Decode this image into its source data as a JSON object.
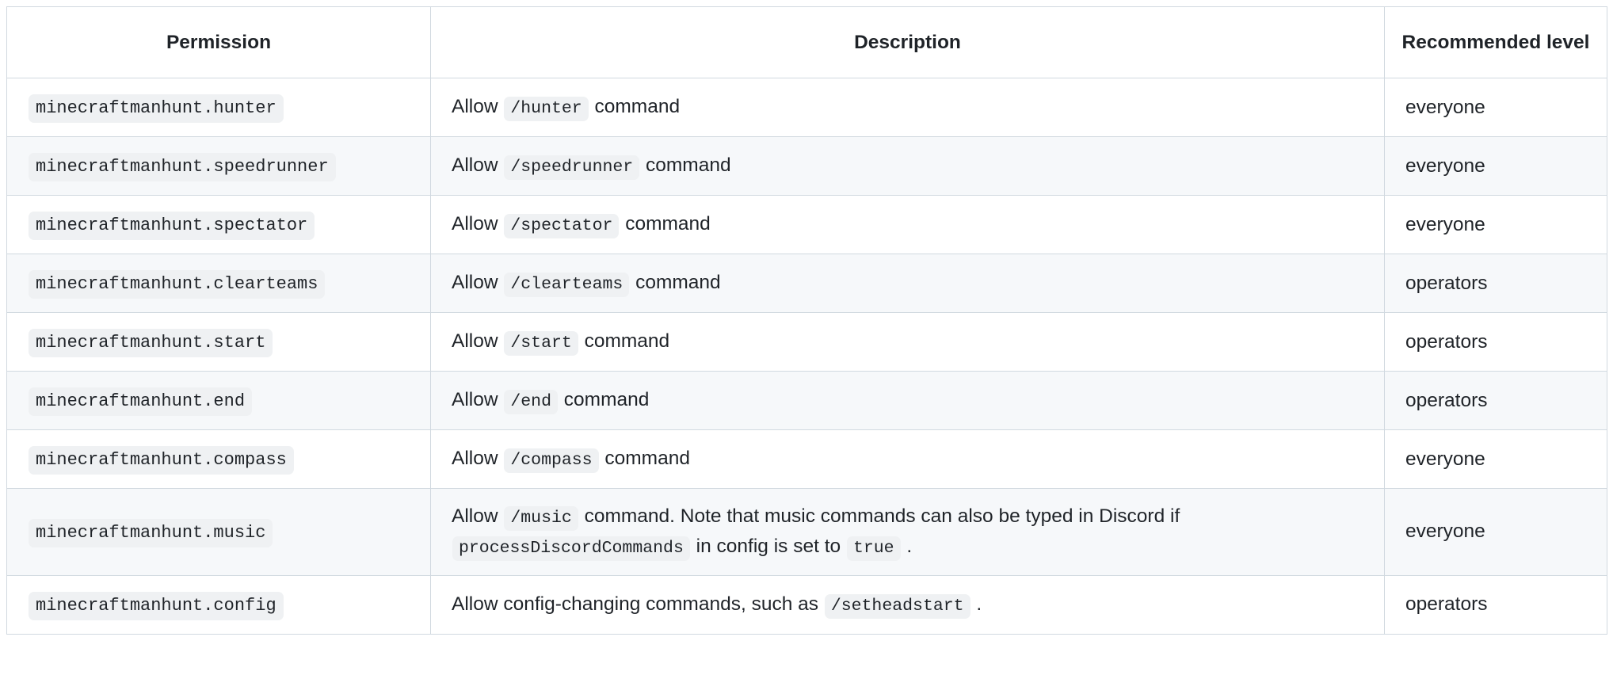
{
  "table": {
    "columns": [
      {
        "key": "permission",
        "label": "Permission",
        "align": "center"
      },
      {
        "key": "description",
        "label": "Description",
        "align": "center"
      },
      {
        "key": "level",
        "label": "Recommended level",
        "align": "center"
      }
    ],
    "headers": {
      "permission": "Permission",
      "description": "Description",
      "level": "Recommended level"
    },
    "rows": [
      {
        "permission": "minecraftmanhunt.hunter",
        "description": {
          "pre": "Allow",
          "code": "/hunter",
          "post": "command"
        },
        "level": "everyone"
      },
      {
        "permission": "minecraftmanhunt.speedrunner",
        "description": {
          "pre": "Allow",
          "code": "/speedrunner",
          "post": "command"
        },
        "level": "everyone"
      },
      {
        "permission": "minecraftmanhunt.spectator",
        "description": {
          "pre": "Allow",
          "code": "/spectator",
          "post": "command"
        },
        "level": "everyone"
      },
      {
        "permission": "minecraftmanhunt.clearteams",
        "description": {
          "pre": "Allow",
          "code": "/clearteams",
          "post": "command"
        },
        "level": "operators"
      },
      {
        "permission": "minecraftmanhunt.start",
        "description": {
          "pre": "Allow",
          "code": "/start",
          "post": "command"
        },
        "level": "operators"
      },
      {
        "permission": "minecraftmanhunt.end",
        "description": {
          "pre": "Allow",
          "code": "/end",
          "post": "command"
        },
        "level": "operators"
      },
      {
        "permission": "minecraftmanhunt.compass",
        "description": {
          "pre": "Allow",
          "code": "/compass",
          "post": "command"
        },
        "level": "everyone"
      },
      {
        "permission": "minecraftmanhunt.music",
        "description": {
          "pre": "Allow",
          "code": "/music",
          "post": "command. Note that music commands can also be typed in Discord if",
          "code2": "processDiscordCommands",
          "post2": "in config is set to",
          "code3": "true",
          "post3": "."
        },
        "level": "everyone"
      },
      {
        "permission": "minecraftmanhunt.config",
        "description": {
          "pre": "Allow config-changing commands, such as",
          "code": "/setheadstart",
          "post": "."
        },
        "level": "operators"
      }
    ]
  },
  "theme": {
    "border_color": "#d1d9e0",
    "row_alt_bg": "#f6f8fa",
    "row_bg": "#ffffff",
    "code_bg": "#eff1f3",
    "text_color": "#1f2328"
  }
}
